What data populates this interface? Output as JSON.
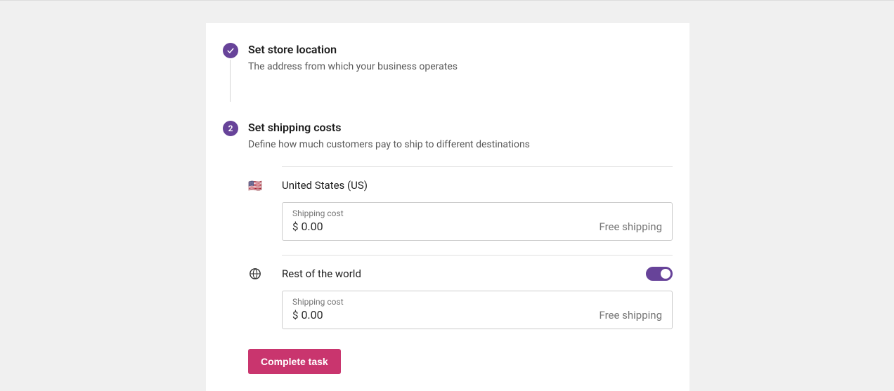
{
  "steps": {
    "store_location": {
      "title": "Set store location",
      "desc": "The address from which your business operates"
    },
    "shipping_costs": {
      "number": "2",
      "title": "Set shipping costs",
      "desc": "Define how much customers pay to ship to different destinations"
    }
  },
  "zones": {
    "us": {
      "flag": "🇺🇸",
      "name": "United States (US)",
      "cost_label": "Shipping cost",
      "currency": "$",
      "value": "0.00",
      "badge": "Free shipping"
    },
    "rest": {
      "name": "Rest of the world",
      "cost_label": "Shipping cost",
      "currency": "$",
      "value": "0.00",
      "badge": "Free shipping"
    }
  },
  "actions": {
    "complete": "Complete task"
  }
}
